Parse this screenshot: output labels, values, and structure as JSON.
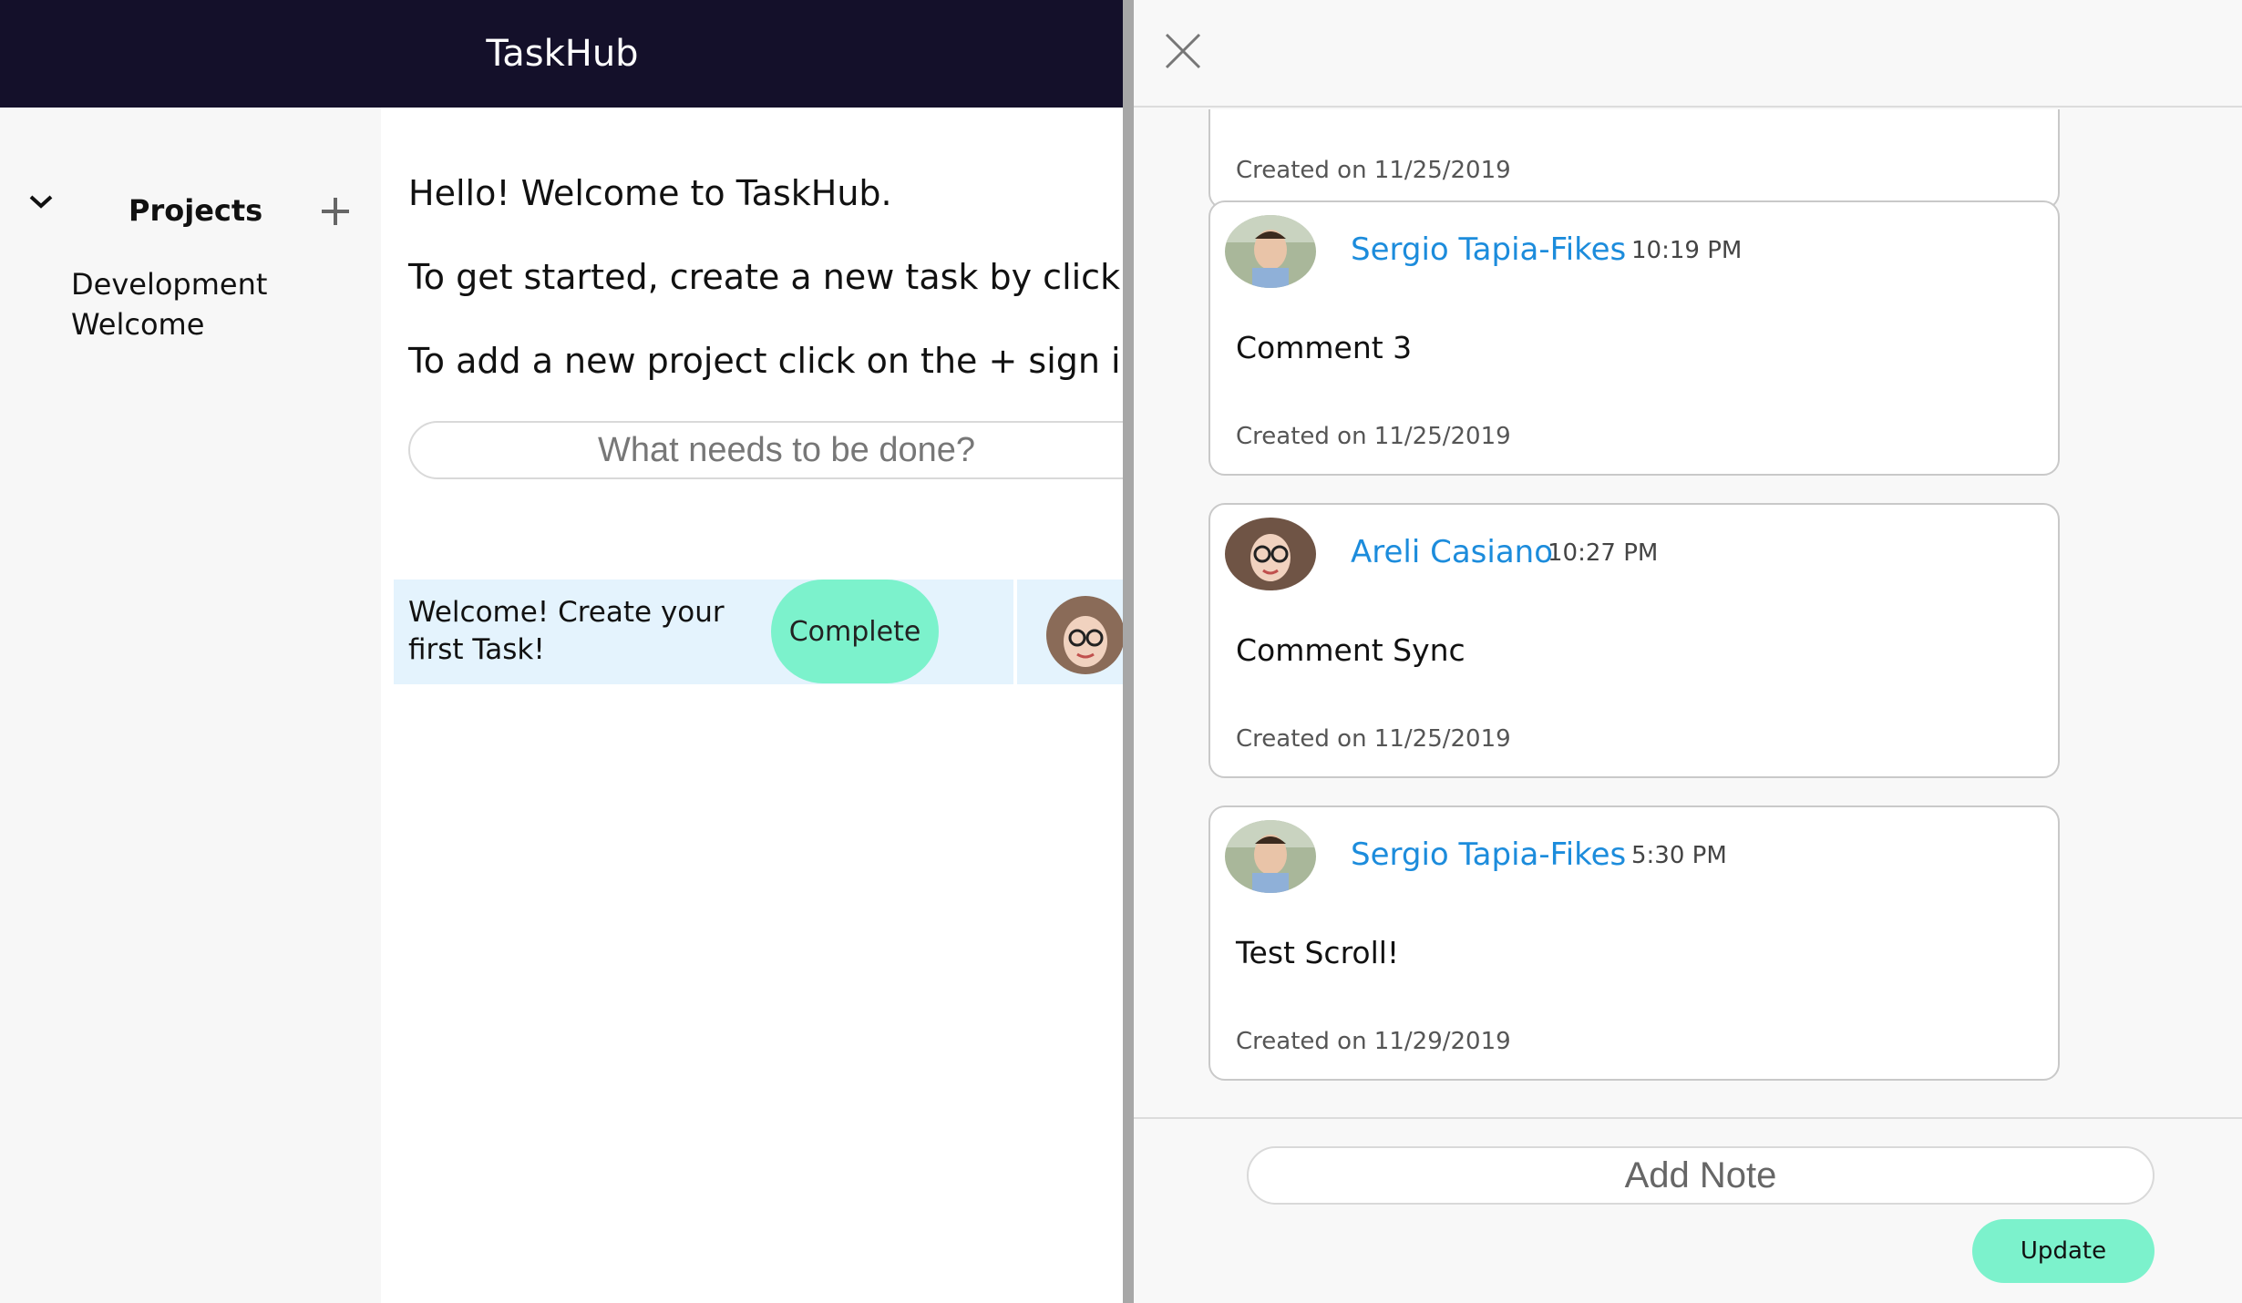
{
  "app": {
    "title": "TaskHub"
  },
  "sidebar": {
    "section_title": "Projects",
    "icons": {
      "collapse": "chevron-down-icon",
      "add": "plus-icon"
    },
    "projects": [
      {
        "label": "Development"
      },
      {
        "label": "Welcome"
      }
    ]
  },
  "main": {
    "intro_lines": [
      "Hello! Welcome to TaskHub.",
      "To get started, create a new task by clicking t",
      "To add a new project click on the + sign in th"
    ],
    "new_task_placeholder": "What needs to be done?",
    "task": {
      "title": "Welcome! Create your first Task!",
      "complete_label": "Complete",
      "highlight_color": "#e4f3fd"
    }
  },
  "drawer": {
    "close_icon": "close-icon",
    "top_card_created": "Created on 11/25/2019",
    "comments": [
      {
        "author": "Sergio Tapia-Fikes",
        "time": "10:19 PM",
        "body": "Comment 3",
        "created": "Created on 11/25/2019"
      },
      {
        "author": "Areli Casiano",
        "time": "10:27 PM",
        "body": "Comment Sync",
        "created": "Created on 11/25/2019"
      },
      {
        "author": "Sergio Tapia-Fikes",
        "time": "5:30 PM",
        "body": "Test Scroll!",
        "created": "Created on 11/29/2019"
      }
    ],
    "note_placeholder": "Add Note",
    "update_label": "Update"
  },
  "colors": {
    "header_bg": "#14102a",
    "accent_green": "#7cf2cc",
    "link_blue": "#1c8cdc"
  }
}
